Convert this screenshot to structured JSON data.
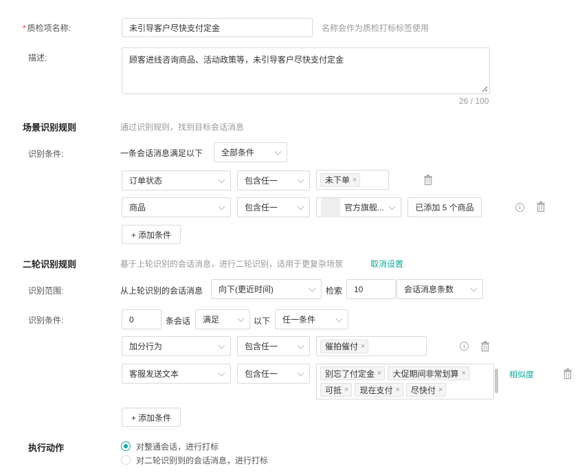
{
  "name_field": {
    "required_mark": "*",
    "label": "质检项名称:",
    "value": "未引导客户尽快支付定金",
    "hint": "名称会作为质检打标标签使用"
  },
  "desc_field": {
    "label": "描述:",
    "value": "顾客进线咨询商品、活动政策等，未引导客户尽快支付定金",
    "counter": "26 / 100"
  },
  "scene": {
    "title": "场景识别规则",
    "hint": "通过识别规则，找到目标会话消息",
    "cond_label": "识别条件:",
    "cond_prefix": "一条会话消息满足以下",
    "cond_mode": "全部条件",
    "rows": [
      {
        "field": "订单状态",
        "op": "包含任一",
        "tags": [
          "未下单"
        ]
      },
      {
        "field": "商品",
        "op": "包含任一",
        "shop": "官方旗舰...",
        "added": "已添加 5 个商品"
      }
    ],
    "add_label": "+ 添加条件"
  },
  "second": {
    "title": "二轮识别规则",
    "hint": "基于上轮识别的会话消息，进行二轮识别，适用于更复杂场景",
    "cancel": "取消设置",
    "range_label": "识别范围:",
    "range_prefix": "从上轮识别的会话消息",
    "direction": "向下(更近时间)",
    "retrieve": "检索",
    "count": "10",
    "unit": "会话消息条数",
    "cond_label": "识别条件:",
    "cond_count": "0",
    "cond_unit": "条会话",
    "cond_satisfy": "满足",
    "cond_below": "以下",
    "cond_mode": "任一条件",
    "rows": [
      {
        "field": "加分行为",
        "op": "包含任一",
        "tags": [
          "催拍催付"
        ]
      },
      {
        "field": "客服发送文本",
        "op": "包含任一",
        "tags": [
          "别忘了付定金",
          "大促期间非常划算",
          "可抵",
          "现在支付",
          "尽快付"
        ],
        "similar": "相似度"
      }
    ],
    "add_label": "+ 添加条件"
  },
  "action": {
    "title": "执行动作",
    "options": [
      "对整通会话，进行打标",
      "对二轮识别到的会话消息，进行打标"
    ],
    "selected": 0
  },
  "colors": {
    "accent": "#13a89e",
    "required": "#f5222d"
  },
  "icons": [
    "trash-icon",
    "info-icon",
    "chevron-down-icon",
    "close-icon",
    "resize-handle-icon"
  ]
}
